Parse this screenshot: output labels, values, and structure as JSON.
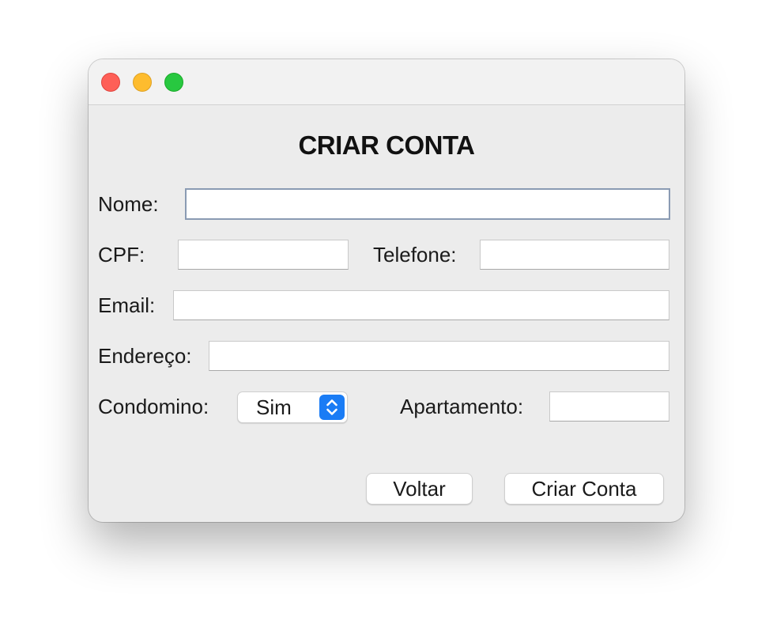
{
  "window": {
    "controls": {
      "close": "close-icon",
      "minimize": "minimize-icon",
      "zoom": "zoom-icon",
      "colors": {
        "close": "#fe5f57",
        "minimize": "#febc2e",
        "zoom": "#28c840"
      }
    },
    "heading": "CRIAR CONTA"
  },
  "form": {
    "nome": {
      "label": "Nome:",
      "value": "",
      "placeholder": ""
    },
    "cpf": {
      "label": "CPF:",
      "value": "",
      "placeholder": ""
    },
    "telefone": {
      "label": "Telefone:",
      "value": "",
      "placeholder": ""
    },
    "email": {
      "label": "Email:",
      "value": "",
      "placeholder": ""
    },
    "endereco": {
      "label": "Endereço:",
      "value": "",
      "placeholder": ""
    },
    "condomino": {
      "label": "Condomino:",
      "selected": "Sim",
      "icon": "chevron-up-down-icon",
      "accent": "#1a7cf5"
    },
    "apartamento": {
      "label": "Apartamento:",
      "value": "",
      "placeholder": ""
    }
  },
  "buttons": {
    "back": "Voltar",
    "create": "Criar Conta"
  }
}
